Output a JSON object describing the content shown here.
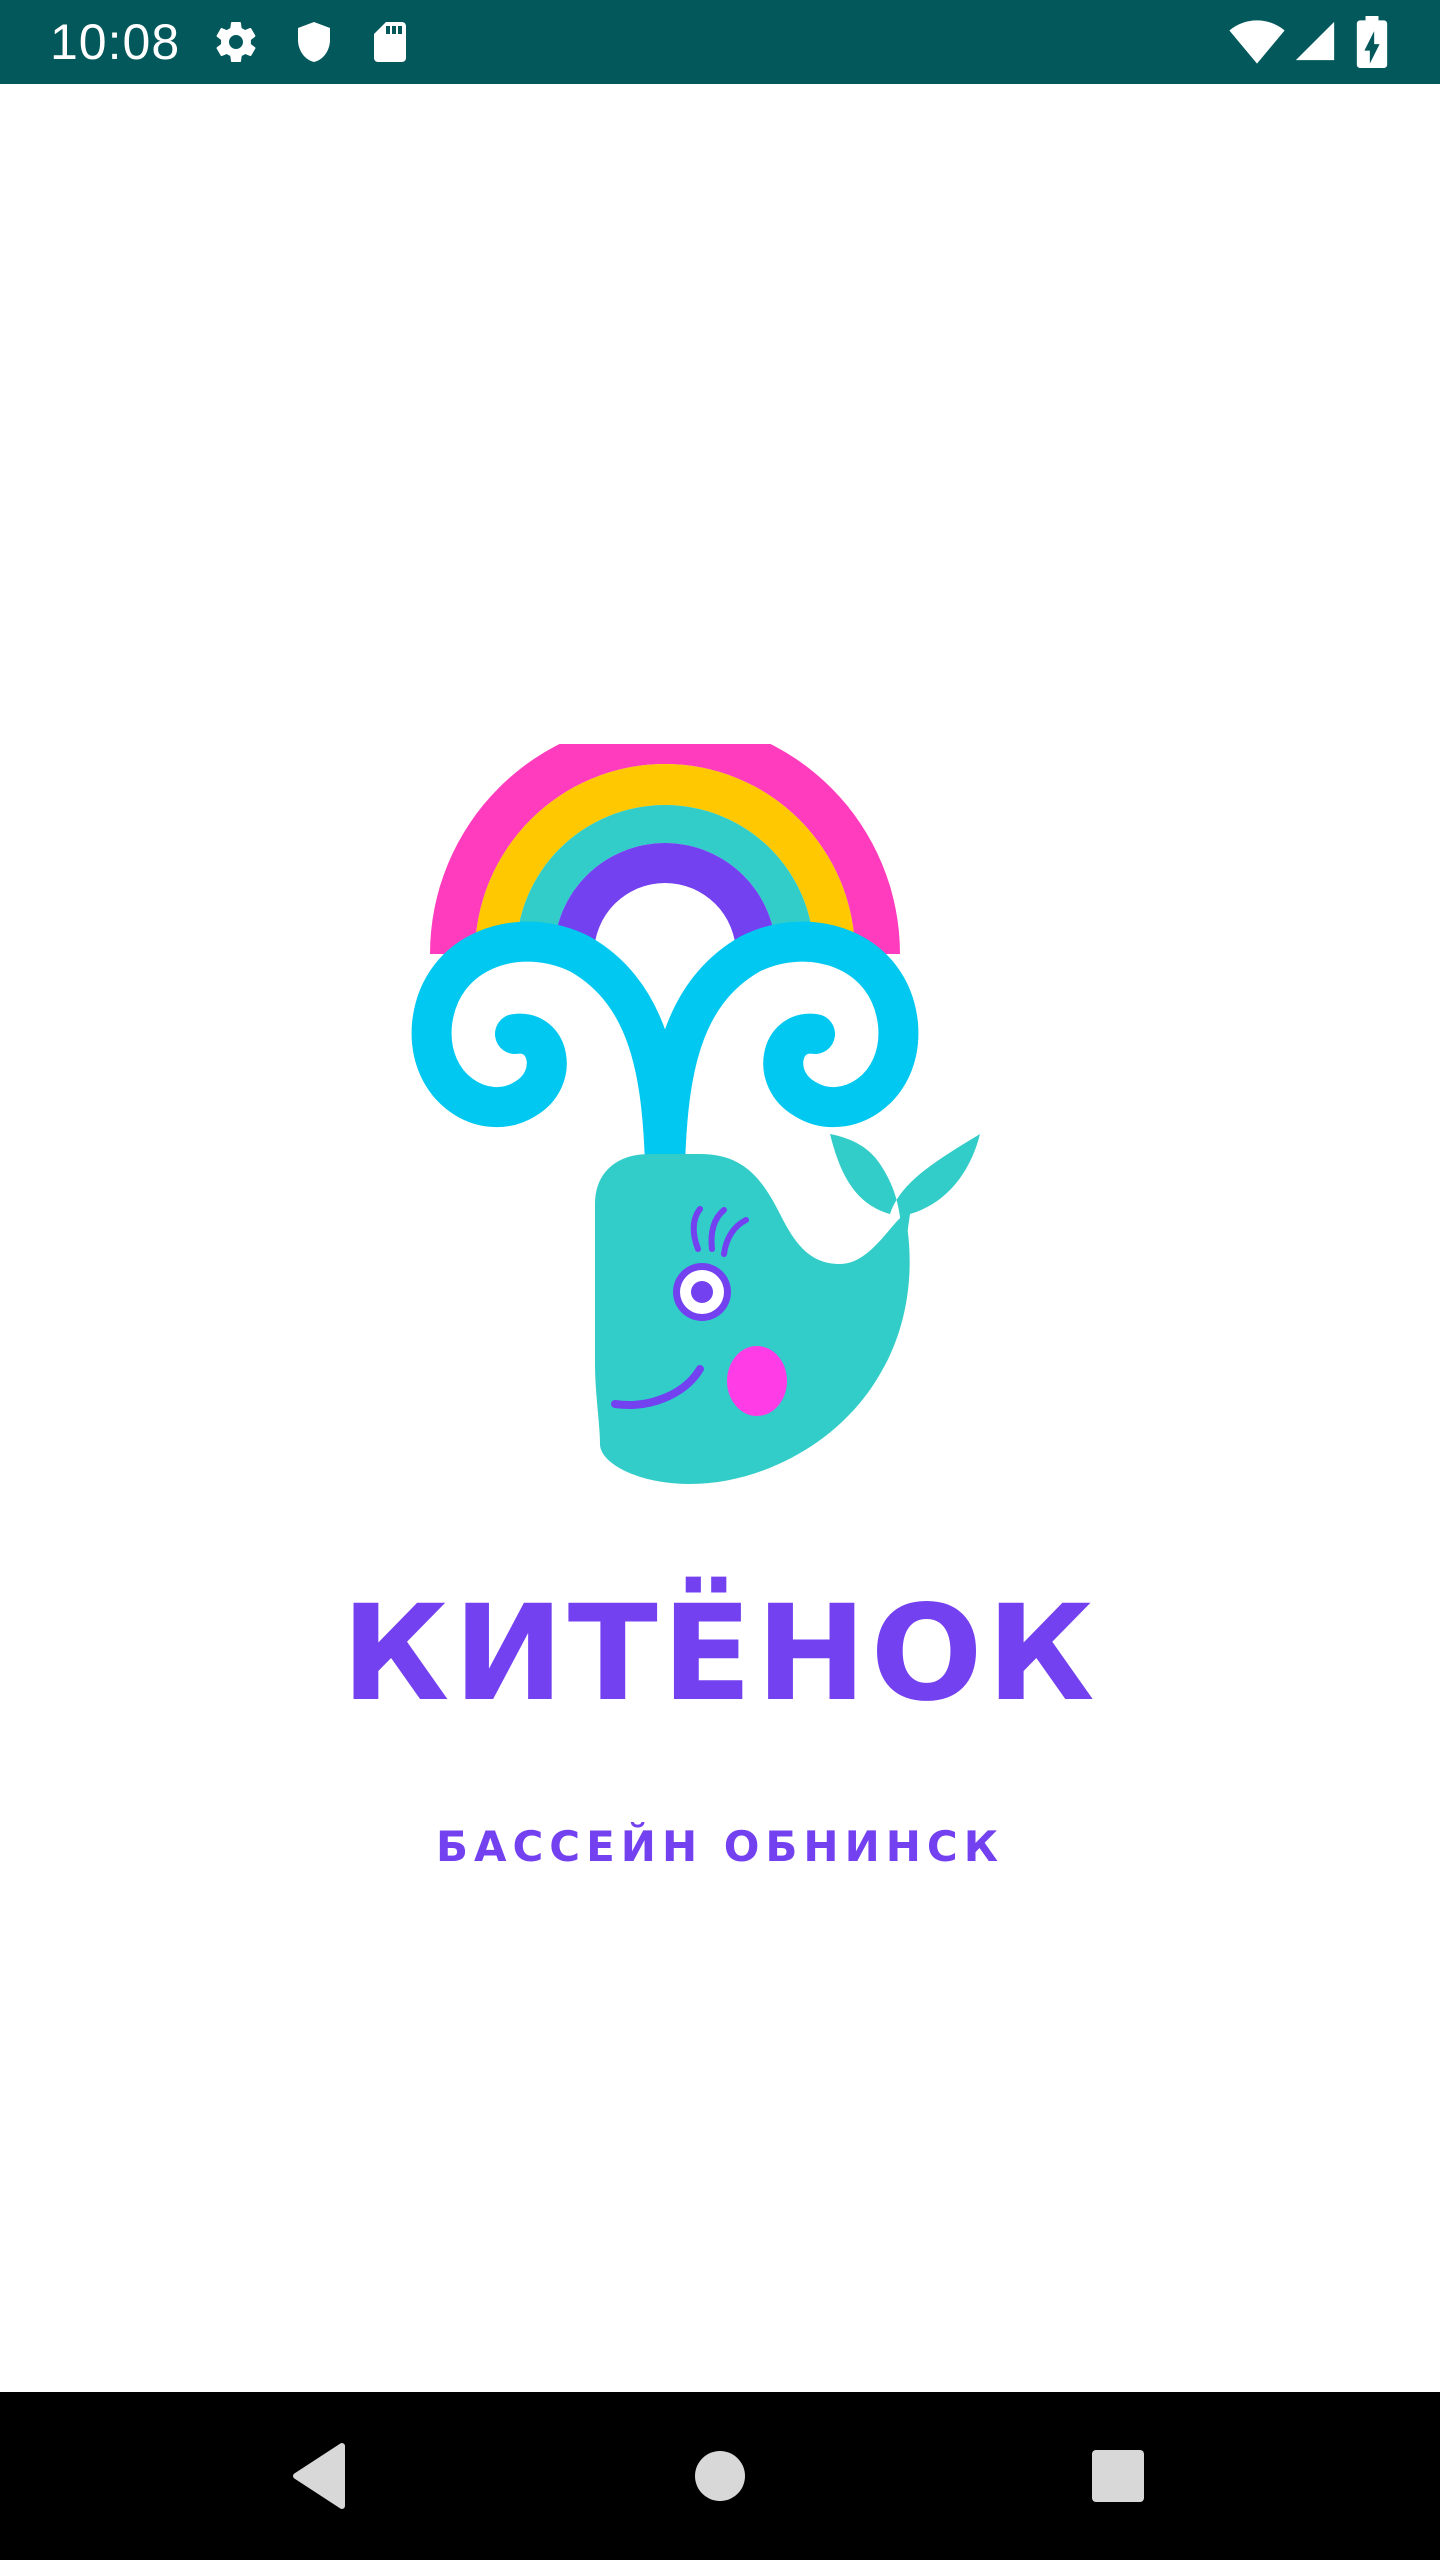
{
  "status_bar": {
    "time": "10:08",
    "icons": [
      "gear-icon",
      "shield-icon",
      "sd-card-icon",
      "wifi-icon",
      "cell-signal-icon",
      "battery-charging-icon"
    ],
    "background": "#02585a"
  },
  "splash": {
    "logo": "whale-with-rainbow-logo",
    "title": "КИТЁНОК",
    "subtitle": "БАССЕЙН ОБНИНСК",
    "brand_color": "#7341f0",
    "colors": {
      "rainbow_pink": "#ff3cbe",
      "rainbow_yellow": "#ffc800",
      "rainbow_teal": "#32cdc8",
      "rainbow_purple": "#7341f0",
      "water_blue": "#00c8f0",
      "whale_teal": "#32cdc8",
      "cheek_pink": "#ff3ce6"
    }
  },
  "nav_bar": {
    "buttons": [
      "back-icon",
      "home-icon",
      "recents-icon"
    ]
  }
}
